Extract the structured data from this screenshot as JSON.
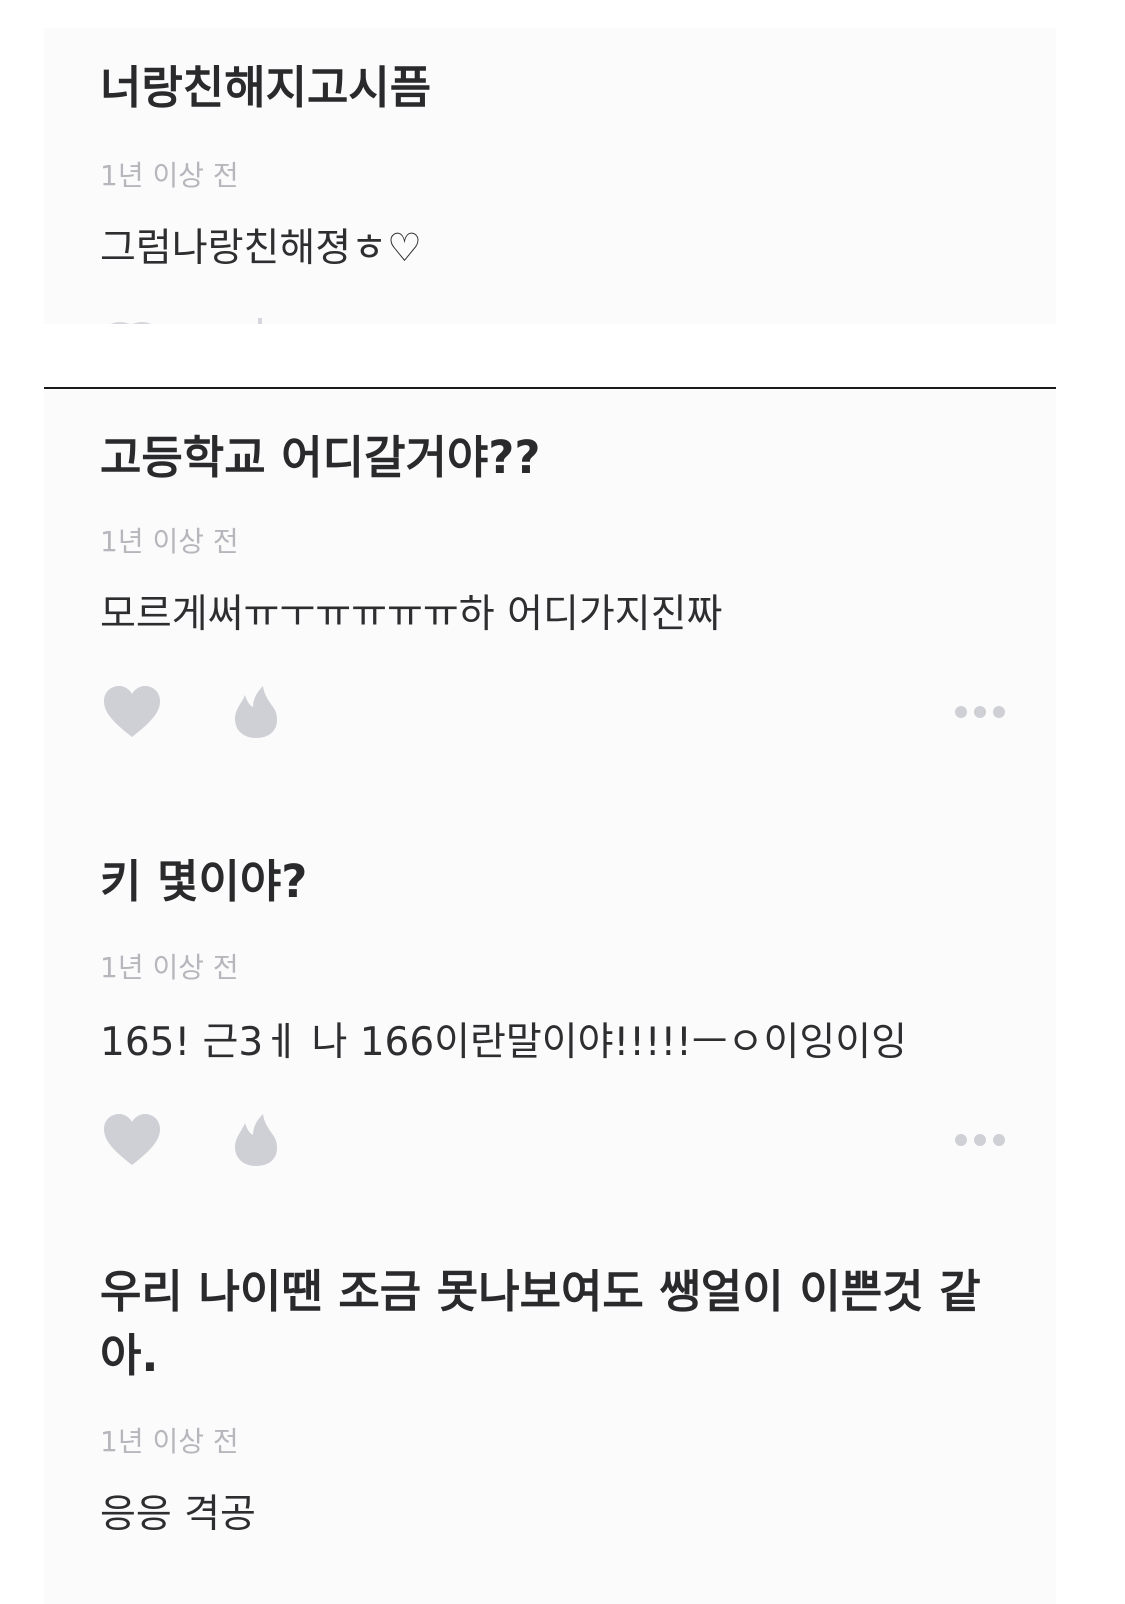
{
  "posts": [
    {
      "title": "너랑친해지고시픔",
      "time": "1년 이상 전",
      "body": "그럼나랑친해졍ㅎ♡"
    },
    {
      "title": "고등학교 어디갈거야??",
      "time": "1년 이상 전",
      "body": "모르게써ㅠㅜㅠㅠㅠㅠ하 어디가지진짜"
    },
    {
      "title": "키 몇이야?",
      "time": "1년 이상 전",
      "body": "165! 근3ㅔ 나 166이란말이야!!!!!ㅡㅇ이잉이잉"
    },
    {
      "title": "우리 나이땐 조금 못나보여도 쌩얼이 이쁜것 같아.",
      "time": "1년 이상 전",
      "body": "응응 격공"
    }
  ],
  "icons": {
    "like": "heart-icon",
    "fire": "fire-icon",
    "more": "more-dots-icon"
  },
  "colors": {
    "icon_gray": "#cfcfd6",
    "title_text": "#2a2a2c",
    "time_text": "#b6b6bc",
    "divider": "#1a1a1a"
  }
}
